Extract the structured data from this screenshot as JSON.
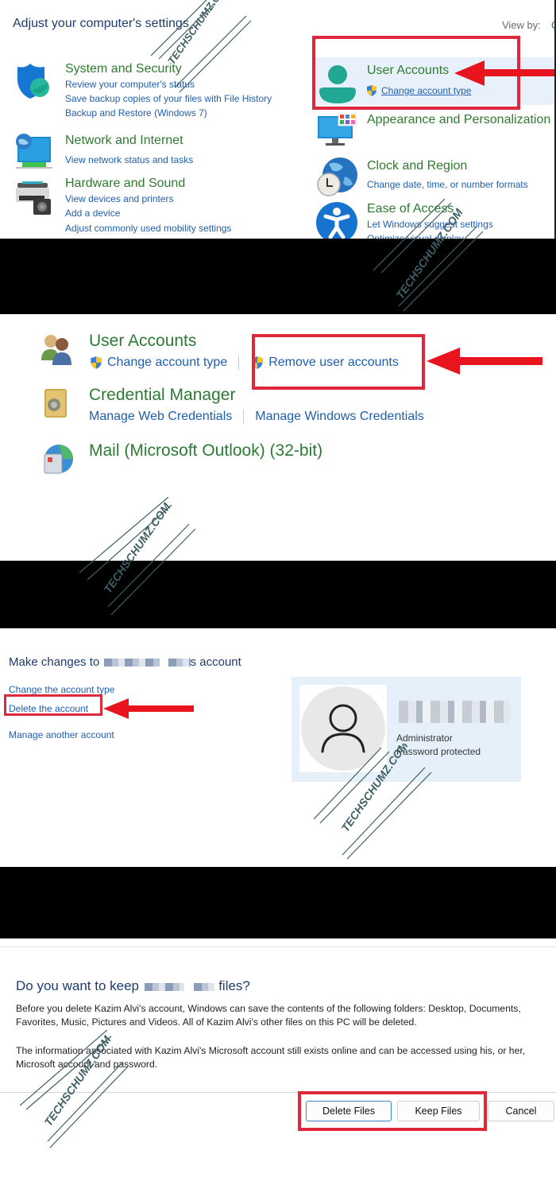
{
  "panel1": {
    "title": "Adjust your computer's settings",
    "view_by_label": "View by:",
    "view_by_value": "C",
    "categories": [
      {
        "name": "System and Security",
        "icon": "shield-icon",
        "links": [
          "Review your computer's status",
          "Save backup copies of your files with File History",
          "Backup and Restore (Windows 7)"
        ]
      },
      {
        "name": "Network and Internet",
        "icon": "network-monitor-icon",
        "links": [
          "View network status and tasks"
        ]
      },
      {
        "name": "Hardware and Sound",
        "icon": "printer-speaker-icon",
        "links": [
          "View devices and printers",
          "Add a device",
          "Adjust commonly used mobility settings"
        ]
      },
      {
        "name": "User Accounts",
        "icon": "user-icon",
        "links": [
          "Change account type"
        ],
        "highlighted": true
      },
      {
        "name": "Appearance and Personalization",
        "icon": "monitor-palette-icon",
        "links": []
      },
      {
        "name": "Clock and Region",
        "icon": "clock-globe-icon",
        "links": [
          "Change date, time, or number formats"
        ]
      },
      {
        "name": "Ease of Access",
        "icon": "accessibility-icon",
        "links": [
          "Let Windows suggest settings",
          "Optimize visual display"
        ]
      }
    ]
  },
  "panel2": {
    "items": [
      {
        "name": "User Accounts",
        "icon": "users-icon",
        "links": [
          "Change account type",
          "Remove user accounts"
        ]
      },
      {
        "name": "Credential Manager",
        "icon": "vault-icon",
        "links": [
          "Manage Web Credentials",
          "Manage Windows Credentials"
        ]
      },
      {
        "name": "Mail (Microsoft Outlook) (32-bit)",
        "icon": "mail-icon",
        "links": []
      }
    ]
  },
  "panel3": {
    "title_prefix": "Make changes to",
    "title_suffix": "s account",
    "links": [
      "Change the account type",
      "Delete the account",
      "Manage another account"
    ],
    "account": {
      "role": "Administrator",
      "status": "Password protected"
    }
  },
  "panel4": {
    "title_prefix": "Do you want to keep",
    "title_suffix": "files?",
    "paragraph1": "Before you delete Kazim Alvi's account, Windows can save the contents of the following folders: Desktop, Documents, Favorites, Music, Pictures and Videos. All of Kazim Alvi's other files on this PC will be deleted.",
    "paragraph2": "The information associated with Kazim Alvi's Microsoft account still exists online and can be accessed using his, or her, Microsoft account and password.",
    "buttons": {
      "delete": "Delete Files",
      "keep": "Keep Files",
      "cancel": "Cancel"
    }
  },
  "watermark": "TECHSCHUMZ.COM",
  "colors": {
    "highlight_red": "#e0283c",
    "arrow_red": "#e8141e",
    "category_green": "#2f7a2f",
    "link_blue": "#1f5fae",
    "title_navy": "#1e3c6e"
  }
}
